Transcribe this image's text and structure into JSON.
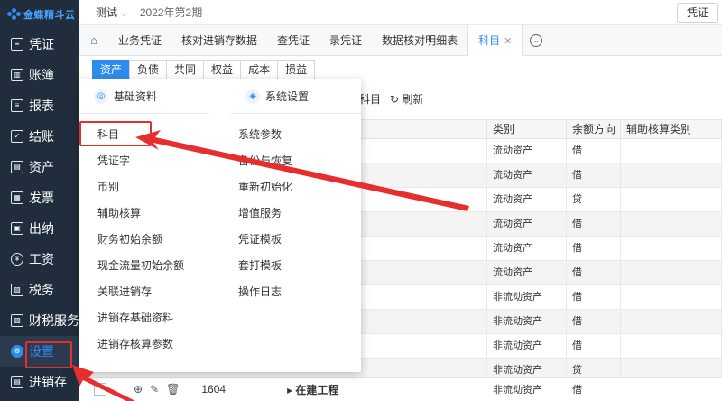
{
  "logo": {
    "text": "金蝶精斗云"
  },
  "sidebar": {
    "items": [
      {
        "label": "凭证",
        "icon": "voucher-icon"
      },
      {
        "label": "账簿",
        "icon": "ledger-icon"
      },
      {
        "label": "报表",
        "icon": "report-icon"
      },
      {
        "label": "结账",
        "icon": "close-books-icon"
      },
      {
        "label": "资产",
        "icon": "asset-icon"
      },
      {
        "label": "发票",
        "icon": "invoice-icon"
      },
      {
        "label": "出纳",
        "icon": "cashier-icon"
      },
      {
        "label": "工资",
        "icon": "salary-icon"
      },
      {
        "label": "税务",
        "icon": "tax-icon"
      },
      {
        "label": "财税服务",
        "icon": "service-icon"
      },
      {
        "label": "设置",
        "icon": "settings-icon"
      },
      {
        "label": "进销存",
        "icon": "inventory-icon"
      }
    ]
  },
  "header": {
    "company": "测试",
    "period": "2022年第2期",
    "right_button": "凭证"
  },
  "tabs": [
    {
      "label": "业务凭证"
    },
    {
      "label": "核对进销存数据"
    },
    {
      "label": "查凭证"
    },
    {
      "label": "录凭证"
    },
    {
      "label": "数据核对明细表"
    },
    {
      "label": "科目"
    }
  ],
  "subtabs": [
    "资产",
    "负债",
    "共同",
    "权益",
    "成本",
    "损益"
  ],
  "toolbar": {
    "subject_fragment": "科目",
    "refresh": "刷新"
  },
  "table": {
    "headers": [
      "",
      "类别",
      "余额方向",
      "辅助核算类别"
    ],
    "rows": [
      {
        "category": "流动资产",
        "direction": "借"
      },
      {
        "category": "流动资产",
        "direction": "借"
      },
      {
        "category": "流动资产",
        "direction": "贷"
      },
      {
        "category": "流动资产",
        "direction": "借"
      },
      {
        "category": "流动资产",
        "direction": "借"
      },
      {
        "category": "流动资产",
        "direction": "借"
      },
      {
        "category": "非流动资产",
        "direction": "借"
      },
      {
        "category": "非流动资产",
        "direction": "借"
      },
      {
        "category": "非流动资产",
        "direction": "借"
      },
      {
        "category": "非流动资产",
        "direction": "贷"
      }
    ],
    "last_row": {
      "code": "1604",
      "name": "在建工程",
      "category": "非流动资产",
      "direction": "借"
    }
  },
  "panel": {
    "left_title": "基础资料",
    "left_items": [
      "科目",
      "凭证字",
      "币别",
      "辅助核算",
      "财务初始余额",
      "现金流量初始余额",
      "关联进销存",
      "进销存基础资料",
      "进销存核算参数"
    ],
    "right_title": "系统设置",
    "right_items": [
      "系统参数",
      "备份与恢复",
      "重新初始化",
      "增值服务",
      "凭证模板",
      "套打模板",
      "操作日志"
    ]
  },
  "colors": {
    "accent": "#2e8cf0",
    "sidebar": "#1f2d3d",
    "highlight": "#e62e2e"
  }
}
